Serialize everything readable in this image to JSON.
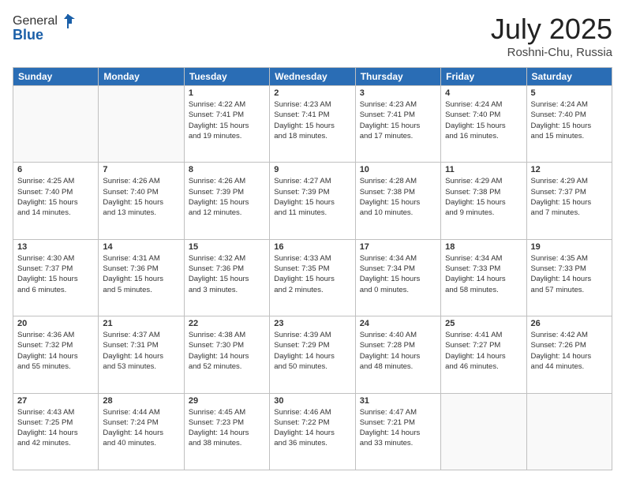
{
  "header": {
    "logo_line1": "General",
    "logo_line2": "Blue",
    "title": "July 2025",
    "location": "Roshni-Chu, Russia"
  },
  "weekdays": [
    "Sunday",
    "Monday",
    "Tuesday",
    "Wednesday",
    "Thursday",
    "Friday",
    "Saturday"
  ],
  "weeks": [
    [
      {
        "day": "",
        "info": ""
      },
      {
        "day": "",
        "info": ""
      },
      {
        "day": "1",
        "info": "Sunrise: 4:22 AM\nSunset: 7:41 PM\nDaylight: 15 hours\nand 19 minutes."
      },
      {
        "day": "2",
        "info": "Sunrise: 4:23 AM\nSunset: 7:41 PM\nDaylight: 15 hours\nand 18 minutes."
      },
      {
        "day": "3",
        "info": "Sunrise: 4:23 AM\nSunset: 7:41 PM\nDaylight: 15 hours\nand 17 minutes."
      },
      {
        "day": "4",
        "info": "Sunrise: 4:24 AM\nSunset: 7:40 PM\nDaylight: 15 hours\nand 16 minutes."
      },
      {
        "day": "5",
        "info": "Sunrise: 4:24 AM\nSunset: 7:40 PM\nDaylight: 15 hours\nand 15 minutes."
      }
    ],
    [
      {
        "day": "6",
        "info": "Sunrise: 4:25 AM\nSunset: 7:40 PM\nDaylight: 15 hours\nand 14 minutes."
      },
      {
        "day": "7",
        "info": "Sunrise: 4:26 AM\nSunset: 7:40 PM\nDaylight: 15 hours\nand 13 minutes."
      },
      {
        "day": "8",
        "info": "Sunrise: 4:26 AM\nSunset: 7:39 PM\nDaylight: 15 hours\nand 12 minutes."
      },
      {
        "day": "9",
        "info": "Sunrise: 4:27 AM\nSunset: 7:39 PM\nDaylight: 15 hours\nand 11 minutes."
      },
      {
        "day": "10",
        "info": "Sunrise: 4:28 AM\nSunset: 7:38 PM\nDaylight: 15 hours\nand 10 minutes."
      },
      {
        "day": "11",
        "info": "Sunrise: 4:29 AM\nSunset: 7:38 PM\nDaylight: 15 hours\nand 9 minutes."
      },
      {
        "day": "12",
        "info": "Sunrise: 4:29 AM\nSunset: 7:37 PM\nDaylight: 15 hours\nand 7 minutes."
      }
    ],
    [
      {
        "day": "13",
        "info": "Sunrise: 4:30 AM\nSunset: 7:37 PM\nDaylight: 15 hours\nand 6 minutes."
      },
      {
        "day": "14",
        "info": "Sunrise: 4:31 AM\nSunset: 7:36 PM\nDaylight: 15 hours\nand 5 minutes."
      },
      {
        "day": "15",
        "info": "Sunrise: 4:32 AM\nSunset: 7:36 PM\nDaylight: 15 hours\nand 3 minutes."
      },
      {
        "day": "16",
        "info": "Sunrise: 4:33 AM\nSunset: 7:35 PM\nDaylight: 15 hours\nand 2 minutes."
      },
      {
        "day": "17",
        "info": "Sunrise: 4:34 AM\nSunset: 7:34 PM\nDaylight: 15 hours\nand 0 minutes."
      },
      {
        "day": "18",
        "info": "Sunrise: 4:34 AM\nSunset: 7:33 PM\nDaylight: 14 hours\nand 58 minutes."
      },
      {
        "day": "19",
        "info": "Sunrise: 4:35 AM\nSunset: 7:33 PM\nDaylight: 14 hours\nand 57 minutes."
      }
    ],
    [
      {
        "day": "20",
        "info": "Sunrise: 4:36 AM\nSunset: 7:32 PM\nDaylight: 14 hours\nand 55 minutes."
      },
      {
        "day": "21",
        "info": "Sunrise: 4:37 AM\nSunset: 7:31 PM\nDaylight: 14 hours\nand 53 minutes."
      },
      {
        "day": "22",
        "info": "Sunrise: 4:38 AM\nSunset: 7:30 PM\nDaylight: 14 hours\nand 52 minutes."
      },
      {
        "day": "23",
        "info": "Sunrise: 4:39 AM\nSunset: 7:29 PM\nDaylight: 14 hours\nand 50 minutes."
      },
      {
        "day": "24",
        "info": "Sunrise: 4:40 AM\nSunset: 7:28 PM\nDaylight: 14 hours\nand 48 minutes."
      },
      {
        "day": "25",
        "info": "Sunrise: 4:41 AM\nSunset: 7:27 PM\nDaylight: 14 hours\nand 46 minutes."
      },
      {
        "day": "26",
        "info": "Sunrise: 4:42 AM\nSunset: 7:26 PM\nDaylight: 14 hours\nand 44 minutes."
      }
    ],
    [
      {
        "day": "27",
        "info": "Sunrise: 4:43 AM\nSunset: 7:25 PM\nDaylight: 14 hours\nand 42 minutes."
      },
      {
        "day": "28",
        "info": "Sunrise: 4:44 AM\nSunset: 7:24 PM\nDaylight: 14 hours\nand 40 minutes."
      },
      {
        "day": "29",
        "info": "Sunrise: 4:45 AM\nSunset: 7:23 PM\nDaylight: 14 hours\nand 38 minutes."
      },
      {
        "day": "30",
        "info": "Sunrise: 4:46 AM\nSunset: 7:22 PM\nDaylight: 14 hours\nand 36 minutes."
      },
      {
        "day": "31",
        "info": "Sunrise: 4:47 AM\nSunset: 7:21 PM\nDaylight: 14 hours\nand 33 minutes."
      },
      {
        "day": "",
        "info": ""
      },
      {
        "day": "",
        "info": ""
      }
    ]
  ]
}
